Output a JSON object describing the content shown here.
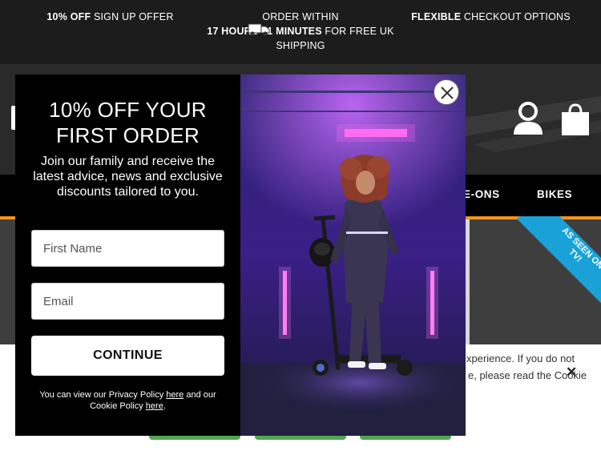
{
  "promo": {
    "p1_bold": "10% OFF",
    "p1_text": " SIGN UP OFFER",
    "p2_line1": "ORDER WITHIN",
    "p2_bold": "17 HOURS 41 MINUTES",
    "p2_text": " FOR FREE UK SHIPPING",
    "p3_bold": "FLEXIBLE",
    "p3_text": " CHECKOUT OPTIONS"
  },
  "nav": {
    "item1": "E-ONS",
    "item2": "BIKES"
  },
  "ribbon": {
    "text": "AS SEEN ON TV!"
  },
  "cookie": {
    "line1": "xperience. If you do not",
    "line2": "e, please read the Cookie",
    "close": "✕"
  },
  "modal": {
    "title": "10% OFF YOUR FIRST ORDER",
    "subtitle": "Join our family and receive the latest advice, news and exclusive discounts tailored to you.",
    "first_name_placeholder": "First Name",
    "email_placeholder": "Email",
    "continue_label": "CONTINUE",
    "policy_prefix": "You can view our Privacy Policy ",
    "policy_link1": "here",
    "policy_mid": " and our Cookie Policy ",
    "policy_link2": "here",
    "policy_suffix": "."
  },
  "colors": {
    "nav_accent": "#f7931e",
    "ribbon": "#1aa1d8",
    "cookie_button": "#53a653"
  },
  "icons": [
    "van-icon",
    "account-icon",
    "shopping-bag-icon",
    "close-icon"
  ]
}
